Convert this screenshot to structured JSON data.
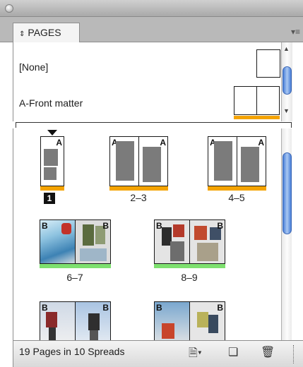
{
  "panel": {
    "tab_label": "PAGES",
    "tab_icon": "double-arrow-icon",
    "menu_icon": "panel-menu-icon"
  },
  "masters": [
    {
      "label": "[None]"
    },
    {
      "label": "A-Front matter"
    }
  ],
  "spreads": [
    {
      "label": "1",
      "pages": 1,
      "master_letter": "A",
      "bar_color": "#f4a300",
      "selected": true
    },
    {
      "label": "2–3",
      "pages": 2,
      "master_letter": "A",
      "bar_color": "#f4a300"
    },
    {
      "label": "4–5",
      "pages": 2,
      "master_letter": "A",
      "bar_color": "#f4a300"
    },
    {
      "label": "6–7",
      "pages": 2,
      "master_letter": "B",
      "bar_color": "#7ee06f"
    },
    {
      "label": "8–9",
      "pages": 2,
      "master_letter": "B",
      "bar_color": "#7ee06f"
    },
    {
      "label": "",
      "pages": 2,
      "master_letter": "B"
    },
    {
      "label": "",
      "pages": 2,
      "master_letter": "B"
    }
  ],
  "status": {
    "text": "19 Pages in 10 Spreads"
  },
  "colors": {
    "master_bar": "#f4a300",
    "b_master_bar": "#7ee06f",
    "scroll_thumb": "#4a7fd8"
  }
}
